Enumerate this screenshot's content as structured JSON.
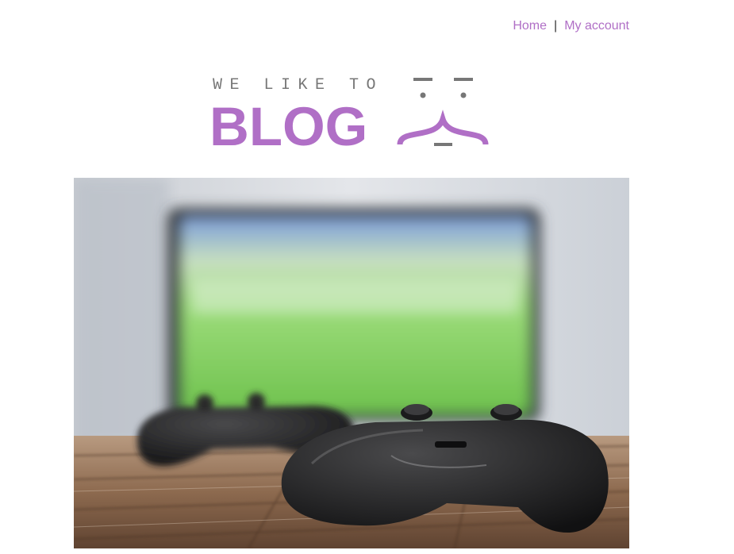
{
  "nav": {
    "home_label": "Home",
    "separator": "|",
    "account_label": "My account"
  },
  "logo": {
    "tagline": "WE LIKE TO",
    "word": "BLOG"
  },
  "hero": {
    "alt": "Two game controllers on a wooden table in front of a television"
  },
  "colors": {
    "accent": "#b06fc6",
    "tagline": "#777777"
  }
}
